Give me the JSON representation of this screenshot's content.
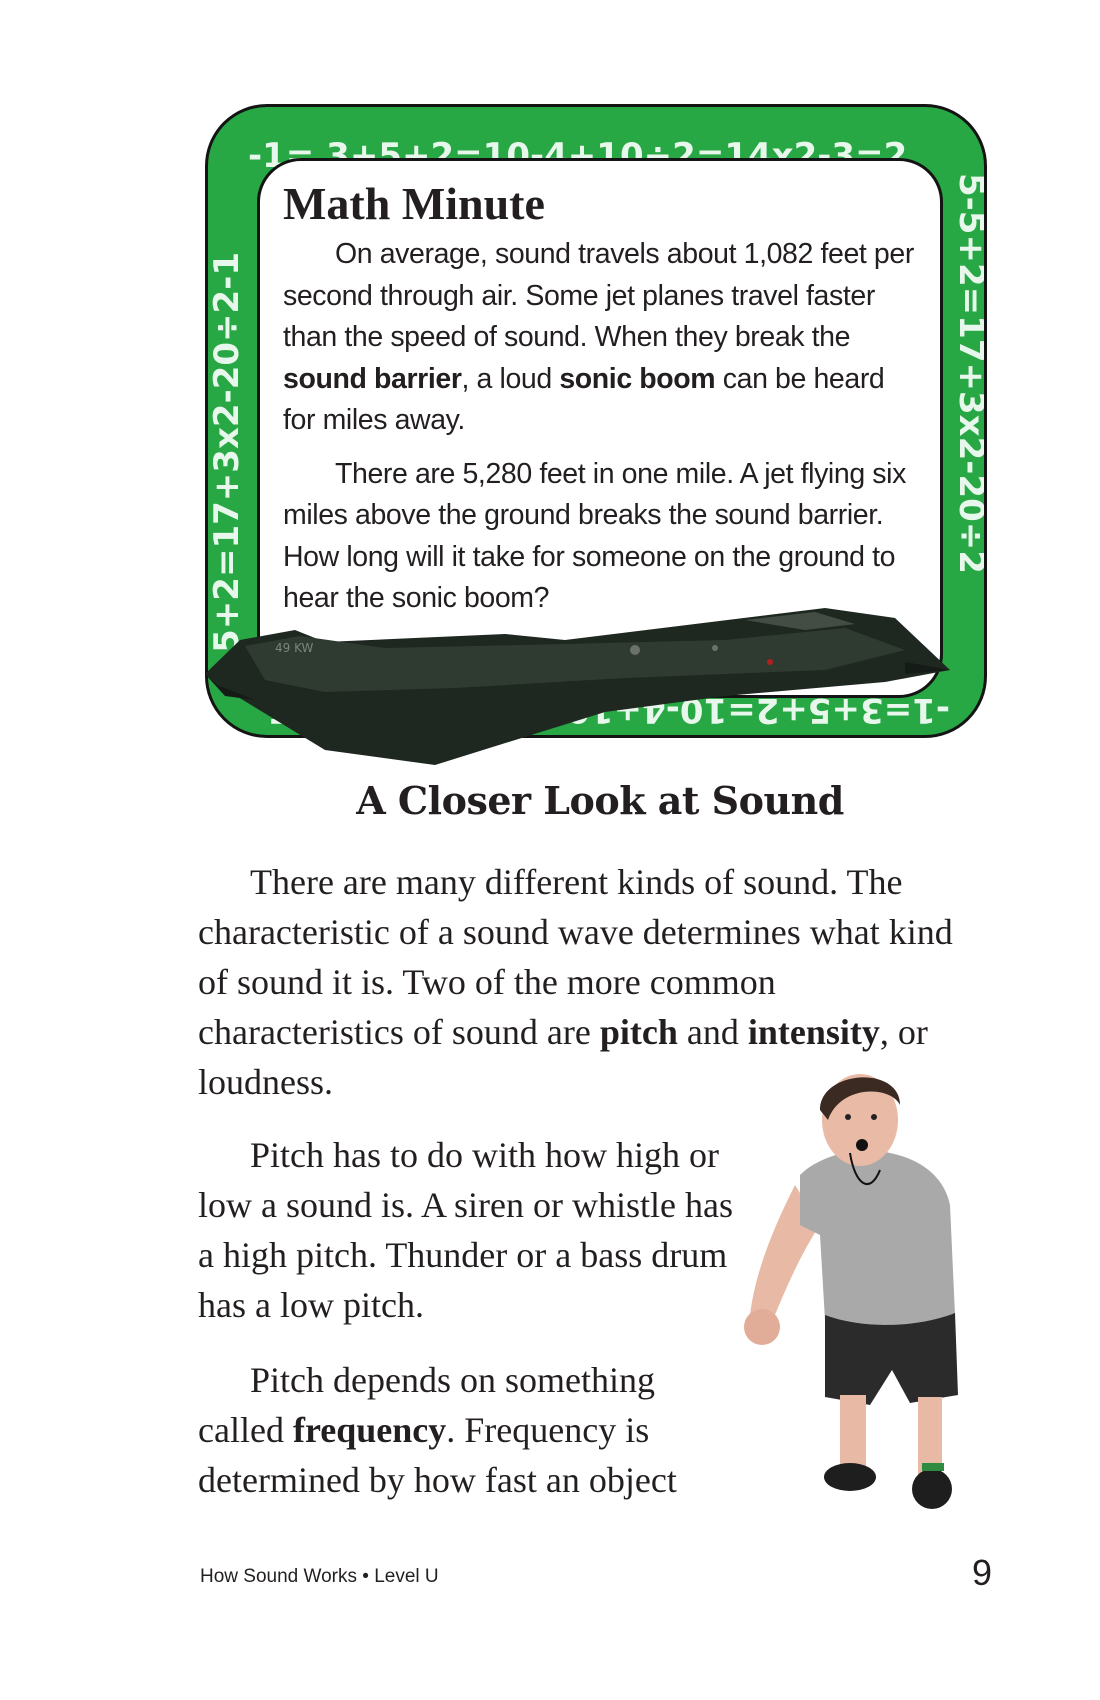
{
  "math_minute": {
    "title": "Math Minute",
    "border_text": {
      "top": "-1= 3+5+2=10-4+10÷2=14x2-3=2",
      "right": "5-5+2=17+3x2-20÷2",
      "bottom": "-1=3+5+2=10-4+10÷2=14x2-3=2 5",
      "left": "-5+2=17+3x2-20÷2-1"
    },
    "paragraph1": {
      "t1": "On average, sound travels about 1,082 feet per second through air. Some jet planes travel faster than the speed of sound. When they break the ",
      "b1": "sound barrier",
      "t2": ", a loud ",
      "b2": "sonic boom",
      "t3": " can be heard for miles away."
    },
    "paragraph2": "There are 5,280 feet in one mile. A jet flying six miles above the ground breaks the sound barrier. How long will it take for someone on the ground to hear the sonic boom?",
    "jet_marking": "49 KW"
  },
  "section": {
    "heading": "A Closer Look at Sound",
    "p1": {
      "t1": "There are many different kinds of sound. The characteristic of a sound wave determines what kind of sound it is. Two of the more common characteristics of sound are ",
      "b1": "pitch",
      "t2": " and ",
      "b2": "intensity",
      "t3": ", or loudness."
    },
    "p2": "Pitch has to do with how high or low a sound is. A siren or whistle has a high pitch. Thunder or a bass drum has a low pitch.",
    "p3": {
      "t1": "Pitch depends on something called ",
      "b1": "frequency",
      "t2": ". Frequency is determined by how fast an object"
    }
  },
  "footer": {
    "title": "How Sound Works • Level U",
    "page": "9"
  },
  "colors": {
    "frame_green": "#27a844",
    "ink": "#231f20"
  }
}
